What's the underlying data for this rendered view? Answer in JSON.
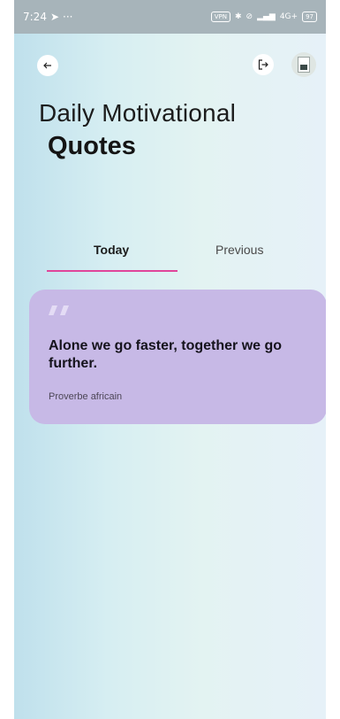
{
  "status_bar": {
    "time": "7:24",
    "dots": "···",
    "vpn": "VPN",
    "network": "4G+",
    "battery": "97"
  },
  "header": {
    "title_line1": "Daily Motivational",
    "title_line2": "Quotes"
  },
  "tabs": [
    {
      "label": "Today",
      "active": true
    },
    {
      "label": "Previous",
      "active": false
    }
  ],
  "quote_card": {
    "text": "Alone we go faster, together we go further.",
    "author": "Proverbe africain"
  },
  "colors": {
    "accent": "#e0459a",
    "card_bg": "#c7b9e6",
    "status_bar_bg": "#a7b4ba"
  },
  "icons": {
    "back": "arrow-left-icon",
    "logout": "logout-icon",
    "send": "send-icon",
    "bluetooth": "bluetooth-icon",
    "signal": "signal-icon"
  }
}
